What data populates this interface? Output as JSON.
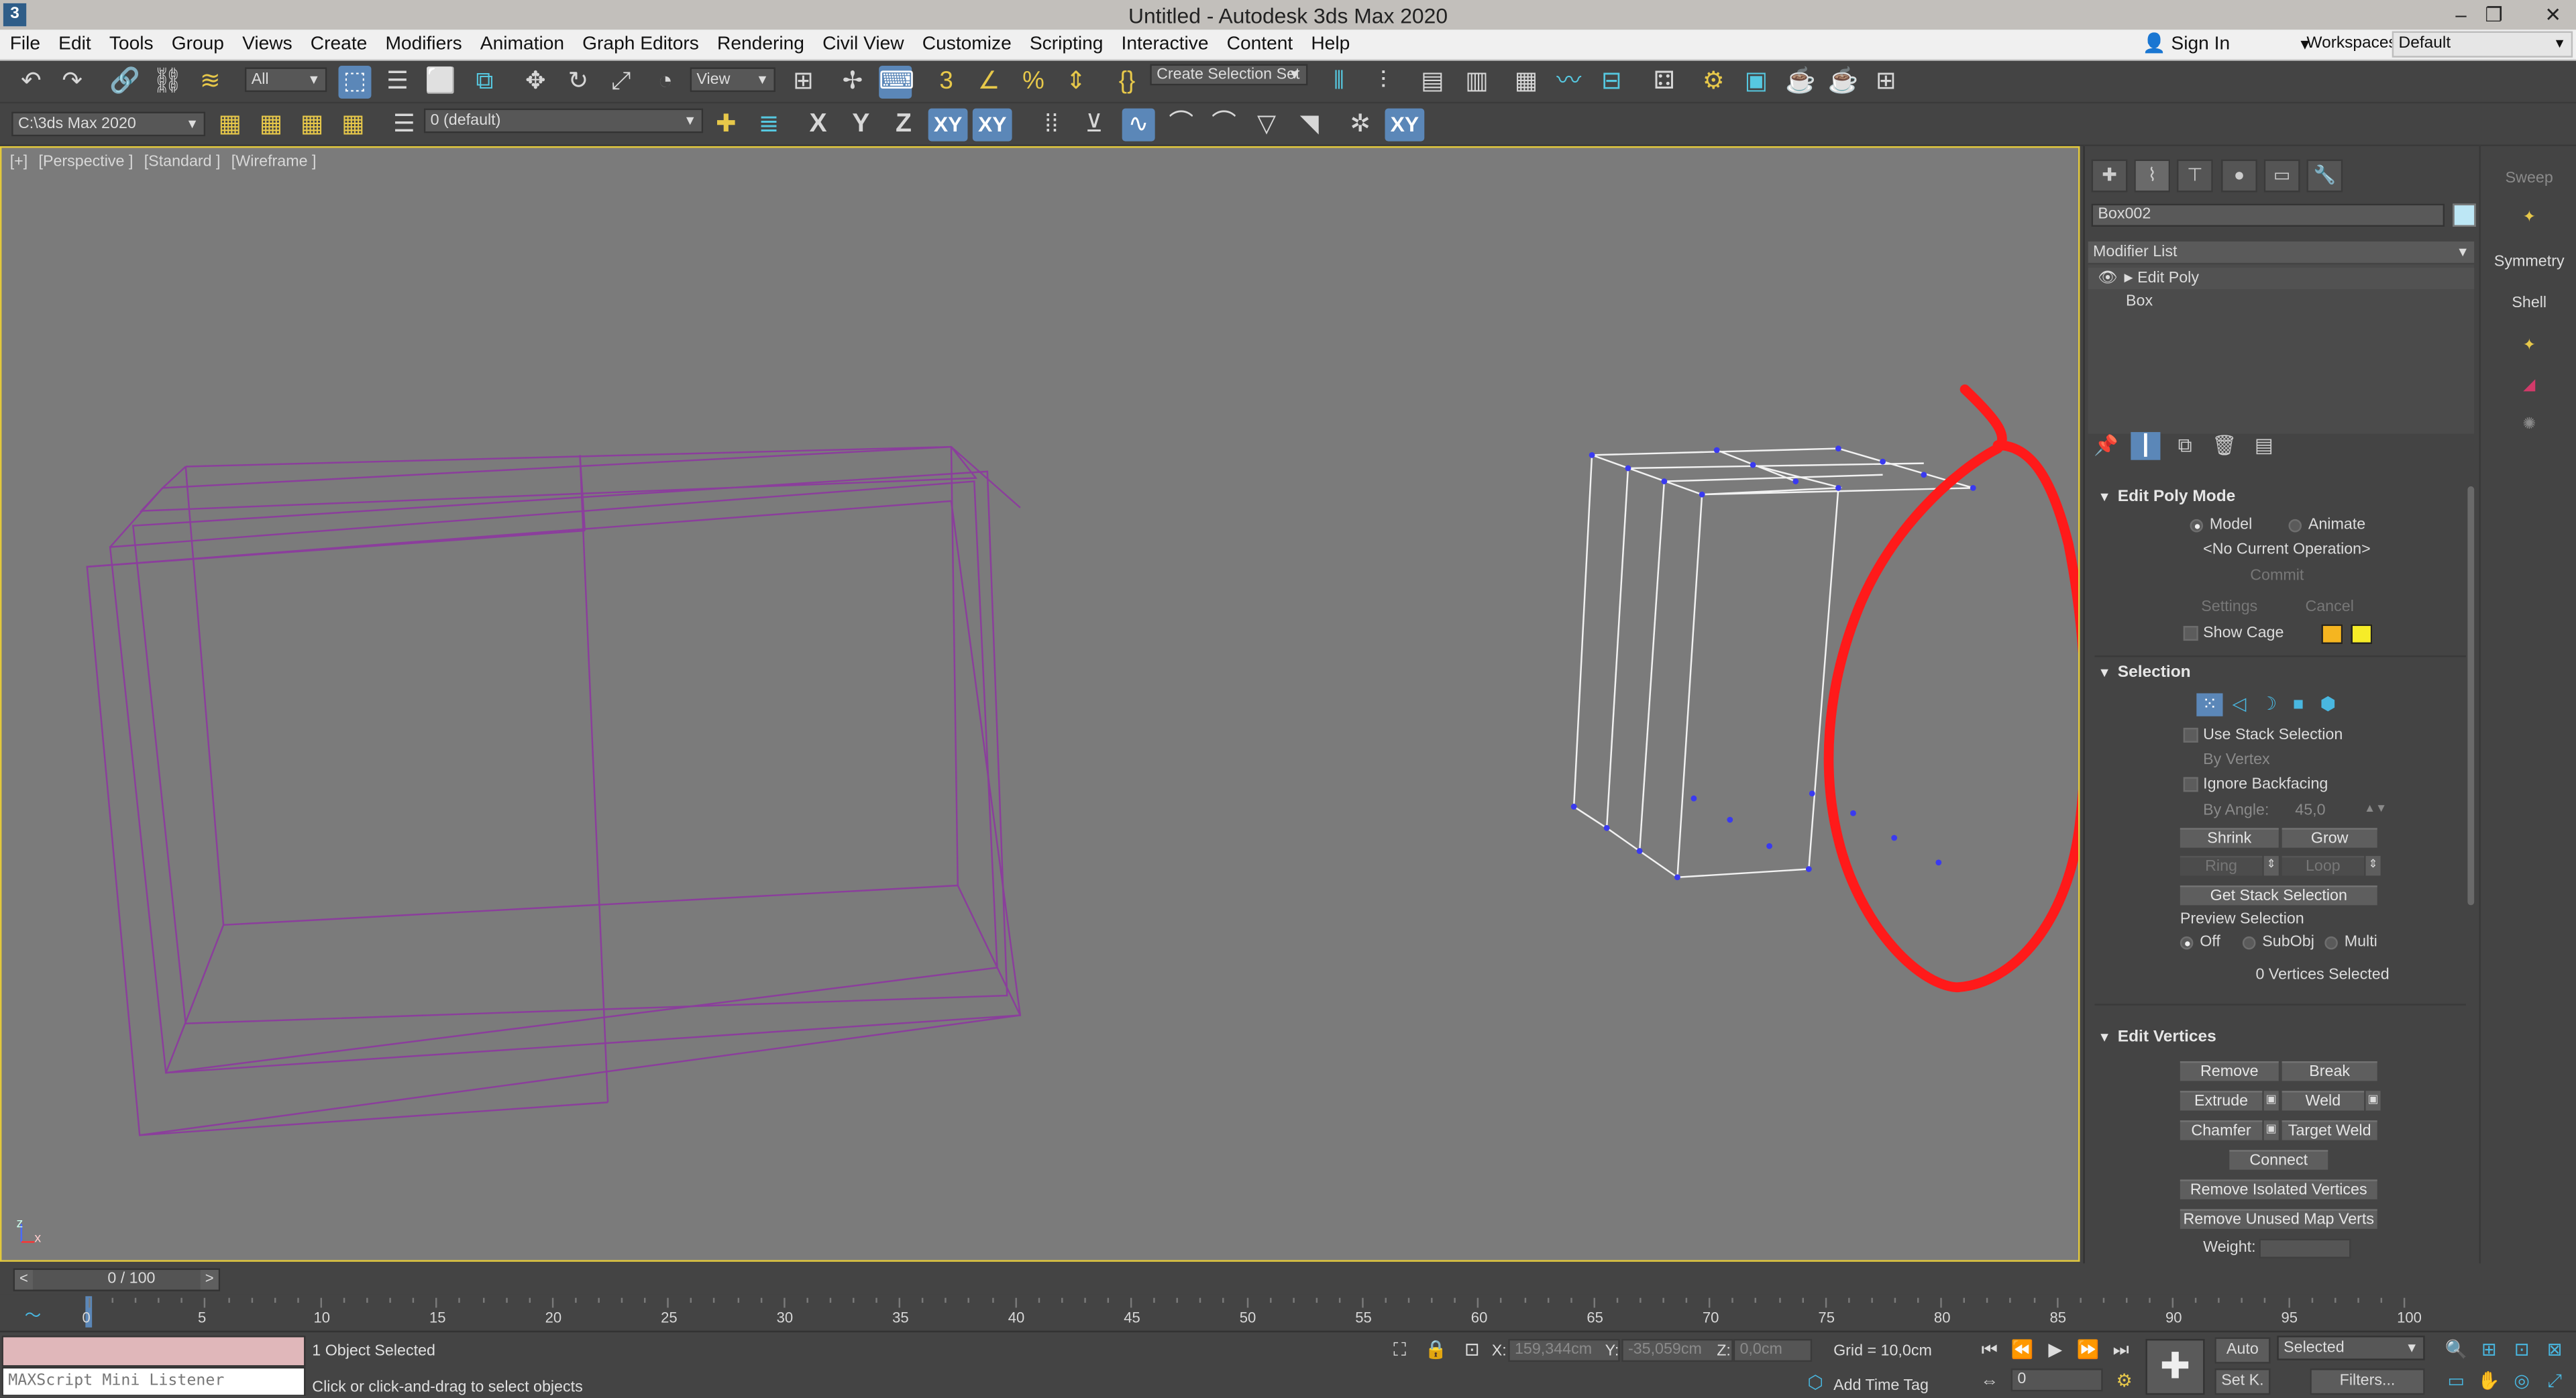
{
  "window": {
    "app_icon": "3",
    "title": "Untitled - Autodesk 3ds Max 2020",
    "minimize": "–",
    "restore": "❐",
    "close": "✕"
  },
  "menu": {
    "items": [
      "File",
      "Edit",
      "Tools",
      "Group",
      "Views",
      "Create",
      "Modifiers",
      "Animation",
      "Graph Editors",
      "Rendering",
      "Civil View",
      "Customize",
      "Scripting",
      "Interactive",
      "Content",
      "Help"
    ],
    "sign_in": "Sign In",
    "workspaces_label": "Workspaces:",
    "workspaces_value": "Default"
  },
  "toolbar": {
    "selection_filter": "All",
    "ref_coord": "View",
    "named_selection": "Create Selection Set",
    "project_path": "C:\\3ds Max 2020",
    "layer": "0 (default)",
    "axis_x": "X",
    "axis_y": "Y",
    "axis_z": "Z",
    "axis_xy": "XY",
    "axis_xy2": "XY"
  },
  "viewport": {
    "labels": [
      "[+]",
      "[Perspective ]",
      "[Standard ]",
      "[Wireframe ]"
    ],
    "axis_z": "z",
    "axis_x": "x",
    "wire_purple": "#8b3e9c",
    "wire_white": "#f2f2f2",
    "vertex_color": "#3a3af0",
    "annotation_color": "#ff1a1a"
  },
  "command_panel": {
    "object_name": "Box002",
    "object_color": "#bde7f5",
    "modifier_list": "Modifier List",
    "stack": [
      "Edit Poly",
      "Box"
    ],
    "edit_poly_mode": {
      "title": "Edit Poly Mode",
      "model": "Model",
      "animate": "Animate",
      "current_op": "<No Current Operation>",
      "commit": "Commit",
      "settings": "Settings",
      "cancel": "Cancel",
      "show_cage": "Show Cage"
    },
    "selection": {
      "title": "Selection",
      "use_stack": "Use Stack Selection",
      "by_vertex": "By Vertex",
      "ignore_backfacing": "Ignore Backfacing",
      "by_angle": "By Angle:",
      "by_angle_value": "45,0",
      "shrink": "Shrink",
      "grow": "Grow",
      "ring": "Ring",
      "loop": "Loop",
      "get_stack": "Get Stack Selection",
      "preview": "Preview Selection",
      "off": "Off",
      "subobj": "SubObj",
      "multi": "Multi",
      "status": "0 Vertices Selected"
    },
    "edit_vertices": {
      "title": "Edit Vertices",
      "remove": "Remove",
      "break": "Break",
      "extrude": "Extrude",
      "weld": "Weld",
      "chamfer": "Chamfer",
      "target_weld": "Target Weld",
      "connect": "Connect",
      "remove_isolated": "Remove Isolated Vertices",
      "remove_unused": "Remove Unused Map Verts",
      "weight": "Weight:"
    }
  },
  "far_right": {
    "sweep": "Sweep",
    "symmetry": "Symmetry",
    "shell": "Shell"
  },
  "time": {
    "frame": "0 / 100",
    "prev": "<",
    "next": ">",
    "ticks": [
      "0",
      "5",
      "10",
      "15",
      "20",
      "25",
      "30",
      "35",
      "40",
      "45",
      "50",
      "55",
      "60",
      "65",
      "70",
      "75",
      "80",
      "85",
      "90",
      "95",
      "100"
    ]
  },
  "status": {
    "maxscript": "MAXScript Mini Listener",
    "selected": "1 Object Selected",
    "hint": "Click or click-and-drag to select objects",
    "x_label": "X:",
    "x_value": "159,344cm",
    "y_label": "Y:",
    "y_value": "-35,059cm",
    "z_label": "Z:",
    "z_value": "0,0cm",
    "grid": "Grid = 10,0cm",
    "add_time_tag": "Add Time Tag",
    "auto": "Auto",
    "set_key": "Set K.",
    "key_filter": "Selected",
    "filters": "Filters...",
    "frame_value": "0"
  }
}
